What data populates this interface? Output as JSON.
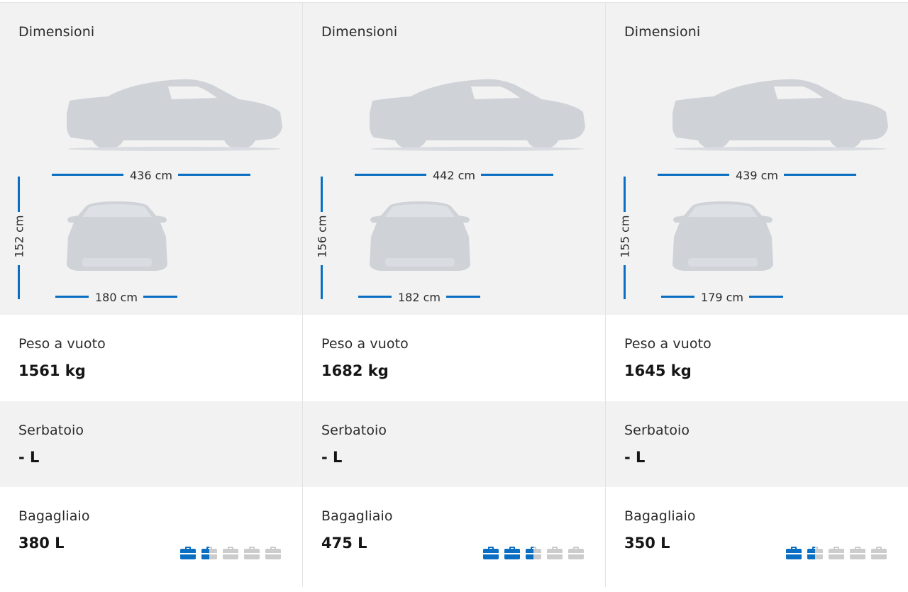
{
  "labels": {
    "dimensions": "Dimensioni",
    "weight": "Peso a vuoto",
    "tank": "Serbatoio",
    "trunk": "Bagagliaio"
  },
  "colors": {
    "accent": "#0a6fc2",
    "car_silhouette": "#cfd3d8",
    "bag_inactive": "#cccccc",
    "panel_gray": "#f2f2f2"
  },
  "cars": [
    {
      "length": "436 cm",
      "height": "152 cm",
      "width": "180 cm",
      "weight": "1561 kg",
      "tank": "- L",
      "trunk": "380 L",
      "trunk_fill": 1.5,
      "trunk_max": 5
    },
    {
      "length": "442 cm",
      "height": "156 cm",
      "width": "182 cm",
      "weight": "1682 kg",
      "tank": "- L",
      "trunk": "475 L",
      "trunk_fill": 2.5,
      "trunk_max": 5
    },
    {
      "length": "439 cm",
      "height": "155 cm",
      "width": "179 cm",
      "weight": "1645 kg",
      "tank": "- L",
      "trunk": "350 L",
      "trunk_fill": 1.5,
      "trunk_max": 5
    }
  ]
}
